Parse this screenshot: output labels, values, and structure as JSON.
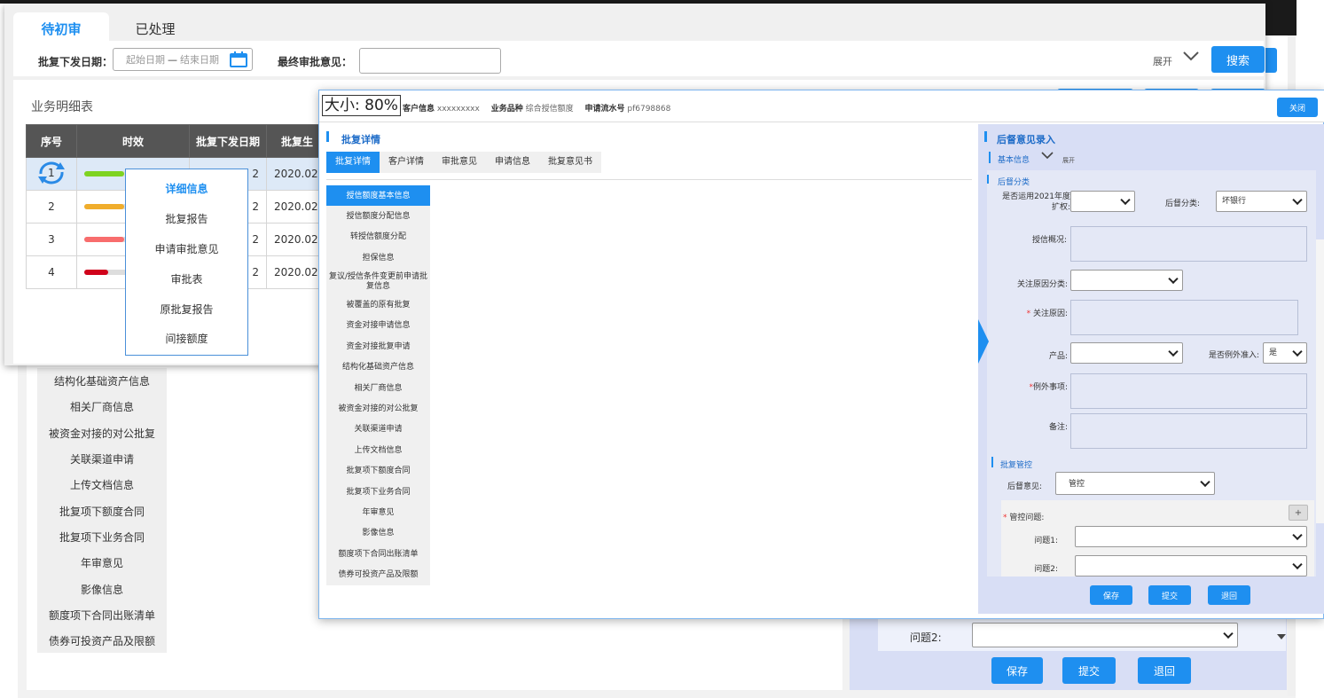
{
  "top_tabs": {
    "pending": "待初审",
    "processed": "已处理"
  },
  "filters": {
    "date_label": "批复下发日期：",
    "start_placeholder": "起始日期",
    "dash": "—",
    "end_placeholder": "结束日期",
    "opinion_label": "最终审批意见：",
    "expand": "展开",
    "search": "搜索"
  },
  "business": {
    "title": "业务明细表",
    "headers": [
      "序号",
      "时效",
      "批复下发日期",
      "批复生"
    ],
    "rows": [
      {
        "no": "1",
        "date": "2",
        "date2": "2020.02.",
        "bar": 0.5,
        "color": "#7ed321"
      },
      {
        "no": "2",
        "date": "2",
        "date2": "2020.02.",
        "bar": 0.5,
        "color": "#f0ad2c"
      },
      {
        "no": "3",
        "date": "2",
        "date2": "2020.02.",
        "bar": 0.5,
        "color": "#f86d6d"
      },
      {
        "no": "4",
        "date": "2",
        "date2": "2020.02.",
        "bar": 0.3,
        "color": "#d0021b"
      }
    ]
  },
  "context_menu": [
    "详细信息",
    "批复报告",
    "申请审批意见",
    "审批表",
    "原批复报告",
    "间接额度"
  ],
  "left_sidebar": [
    "结构化基础资产信息",
    "相关厂商信息",
    "被资金对接的对公批复",
    "关联渠道申请",
    "上传文档信息",
    "批复项下额度合同",
    "批复项下业务合同",
    "年审意见",
    "影像信息",
    "额度项下合同出账清单",
    "债券可投资产品及限额"
  ],
  "bottom_right": {
    "q2_label": "问题2:",
    "save": "保存",
    "submit": "提交",
    "back": "退回"
  },
  "dialog": {
    "zoom": "大小: 80%",
    "customer_label": "客户信息",
    "customer_value": "xxxxxxxxx",
    "product_label": "业务品种",
    "product_value": "综合授信额度",
    "serial_label": "申请流水号",
    "serial_value": "pf6798868",
    "close": "关闭",
    "section_title": "批复详情",
    "tabs": [
      "批复详情",
      "客户详情",
      "审批意见",
      "申请信息",
      "批复意见书"
    ],
    "sidebar": [
      "授信额度基本信息",
      "授信额度分配信息",
      "转授信额度分配",
      "担保信息",
      "复议/授信条件变更前申请批复信息",
      "被覆盖的原有批复",
      "资金对接申请信息",
      "资金对接批复申请",
      "结构化基础资产信息",
      "相关厂商信息",
      "被资金对接的对公批复",
      "关联渠道申请",
      "上传文档信息",
      "批复项下额度合同",
      "批复项下业务合同",
      "年审意见",
      "影像信息",
      "额度项下合同出账清单",
      "债券可投资产品及限额"
    ]
  },
  "right_panel": {
    "title": "后督意见录入",
    "basic_info": "基本信息",
    "expand": "展开",
    "category_title": "后督分类",
    "q2021_label": "是否运用2021年度扩权:",
    "category_label": "后督分类:",
    "category_value": "坏银行",
    "overview_label": "授信概况:",
    "focus_cat_label": "关注原因分类:",
    "required_star": "*",
    "focus_reason_label": "关注原因:",
    "product_label": "产品:",
    "exception_label": "是否例外准入:",
    "exception_value": "是",
    "exception_item_label": "例外事项:",
    "remark_label": "备注:",
    "control_title": "批复管控",
    "opinion_label": "后督意见:",
    "opinion_value": "管控",
    "control_issue_label": "管控问题:",
    "plus": "+",
    "q1_label": "问题1:",
    "q2_label": "问题2:",
    "save": "保存",
    "submit": "提交",
    "back": "退回"
  }
}
